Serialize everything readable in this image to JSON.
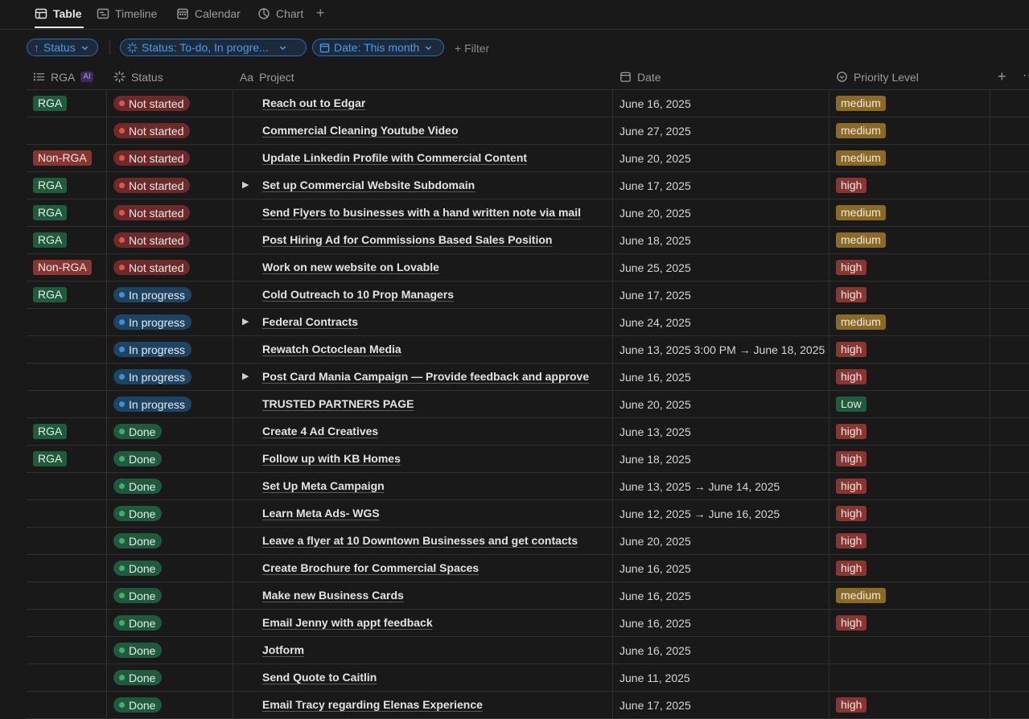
{
  "tabs": [
    {
      "label": "Table",
      "icon": "table-icon",
      "active": true
    },
    {
      "label": "Timeline",
      "icon": "timeline-icon",
      "active": false
    },
    {
      "label": "Calendar",
      "icon": "calendar-icon",
      "active": false
    },
    {
      "label": "Chart",
      "icon": "chart-icon",
      "active": false
    }
  ],
  "tab_add": "+",
  "filters": {
    "sort_label": "Status",
    "status_filter": "Status: To-do, In progre...",
    "date_filter": "Date: This month",
    "add_filter": "Filter"
  },
  "columns": {
    "rga": "RGA",
    "rga_badge": "AI",
    "status": "Status",
    "project_prefix": "Aa",
    "project": "Project",
    "date": "Date",
    "priority": "Priority Level",
    "add": "+",
    "more": "···"
  },
  "colors": {
    "background": "#191919",
    "accent": "#4a9bea",
    "not_started": "#e0554e",
    "in_progress": "#3e8fd6",
    "done": "#3fb06f",
    "medium": "#8c6a23",
    "high": "#8a3530",
    "low": "#1f5c3b"
  },
  "rows": [
    {
      "rga": "RGA",
      "status": "Not started",
      "toggle": "",
      "project": "Reach out to Edgar",
      "date": "June 16, 2025",
      "priority": "medium"
    },
    {
      "rga": "",
      "status": "Not started",
      "toggle": "",
      "project": "Commercial Cleaning Youtube Video",
      "date": "June 27, 2025",
      "priority": "medium"
    },
    {
      "rga": "Non-RGA",
      "status": "Not started",
      "toggle": "",
      "project": "Update Linkedin Profile with Commercial Content",
      "date": "June 20, 2025",
      "priority": "medium"
    },
    {
      "rga": "RGA",
      "status": "Not started",
      "toggle": "▶",
      "project": "Set up Commercial Website Subdomain",
      "date": "June 17, 2025",
      "priority": "high"
    },
    {
      "rga": "RGA",
      "status": "Not started",
      "toggle": "",
      "project": "Send Flyers to businesses with a hand written note via mail",
      "date": "June 20, 2025",
      "priority": "medium"
    },
    {
      "rga": "RGA",
      "status": "Not started",
      "toggle": "",
      "project": "Post Hiring Ad for Commissions Based Sales Position",
      "date": "June 18, 2025",
      "priority": "medium"
    },
    {
      "rga": "Non-RGA",
      "status": "Not started",
      "toggle": "",
      "project": "Work on new website on Lovable",
      "date": "June 25, 2025",
      "priority": "high"
    },
    {
      "rga": "RGA",
      "status": "In progress",
      "toggle": "",
      "project": "Cold Outreach to 10 Prop Managers",
      "date": "June 17, 2025",
      "priority": "high"
    },
    {
      "rga": "",
      "status": "In progress",
      "toggle": "▶",
      "project": "Federal Contracts",
      "date": "June 24, 2025",
      "priority": "medium"
    },
    {
      "rga": "",
      "status": "In progress",
      "toggle": "",
      "project": "Rewatch Octoclean Media",
      "date": "June 13, 2025 3:00 PM → June 18, 2025",
      "priority": "high"
    },
    {
      "rga": "",
      "status": "In progress",
      "toggle": "▶",
      "project": "Post Card Mania Campaign — Provide feedback and approve",
      "date": "June 16, 2025",
      "priority": "high"
    },
    {
      "rga": "",
      "status": "In progress",
      "toggle": "",
      "project": "TRUSTED PARTNERS PAGE",
      "date": "June 20, 2025",
      "priority": "Low"
    },
    {
      "rga": "RGA",
      "status": "Done",
      "toggle": "",
      "project": "Create 4 Ad Creatives",
      "date": "June 13, 2025",
      "priority": "high"
    },
    {
      "rga": "RGA",
      "status": "Done",
      "toggle": "",
      "project": "Follow up with KB Homes",
      "date": "June 18, 2025",
      "priority": "high"
    },
    {
      "rga": "",
      "status": "Done",
      "toggle": "",
      "project": "Set Up Meta Campaign",
      "date": "June 13, 2025 → June 14, 2025",
      "priority": "high"
    },
    {
      "rga": "",
      "status": "Done",
      "toggle": "",
      "project": "Learn Meta Ads- WGS",
      "date": "June 12, 2025 → June 16, 2025",
      "priority": "high"
    },
    {
      "rga": "",
      "status": "Done",
      "toggle": "",
      "project": "Leave a flyer at 10 Downtown Businesses and get contacts",
      "date": "June 20, 2025",
      "priority": "high"
    },
    {
      "rga": "",
      "status": "Done",
      "toggle": "",
      "project": "Create Brochure for Commercial Spaces",
      "date": "June 16, 2025",
      "priority": "high"
    },
    {
      "rga": "",
      "status": "Done",
      "toggle": "",
      "project": "Make new Business Cards",
      "date": "June 16, 2025",
      "priority": "medium"
    },
    {
      "rga": "",
      "status": "Done",
      "toggle": "",
      "project": "Email Jenny with appt feedback",
      "date": "June 16, 2025",
      "priority": "high"
    },
    {
      "rga": "",
      "status": "Done",
      "toggle": "",
      "project": "Jotform",
      "date": "June 16, 2025",
      "priority": ""
    },
    {
      "rga": "",
      "status": "Done",
      "toggle": "",
      "project": "Send Quote to Caitlin",
      "date": "June 11, 2025",
      "priority": ""
    },
    {
      "rga": "",
      "status": "Done",
      "toggle": "",
      "project": "Email Tracy regarding Elenas Experience",
      "date": "June 17, 2025",
      "priority": "high"
    }
  ]
}
